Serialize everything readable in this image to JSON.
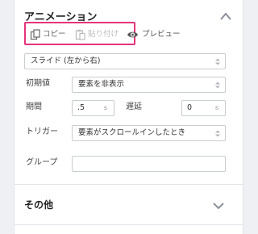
{
  "animation_section": {
    "title": "アニメーション",
    "actions": {
      "copy": "コピー",
      "paste": "貼り付け",
      "preview": "プレビュー"
    },
    "effect_select": {
      "value": "スライド (左から右)"
    },
    "initial_value": {
      "label": "初期値",
      "value": "要素を非表示"
    },
    "duration": {
      "label": "期間",
      "value": ".5",
      "unit": "s"
    },
    "delay": {
      "label": "遅延",
      "value": "0",
      "unit": "s"
    },
    "trigger": {
      "label": "トリガー",
      "value": "要素がスクロールインしたとき"
    },
    "group": {
      "label": "グループ",
      "value": ""
    }
  },
  "other_section": {
    "title": "その他"
  },
  "colors": {
    "highlight": "#e5347a",
    "border": "#c9ccd1"
  }
}
